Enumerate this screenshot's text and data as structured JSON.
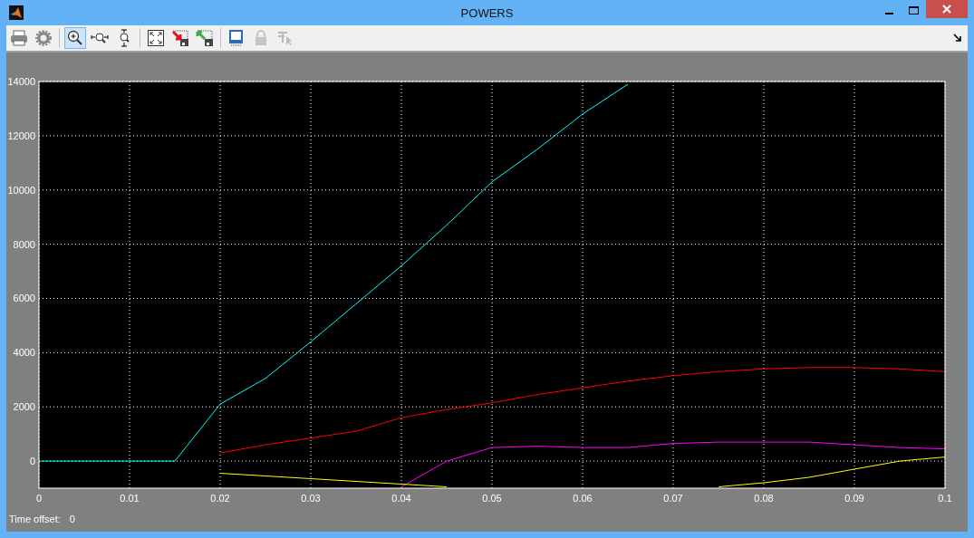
{
  "window": {
    "title": "POWERS"
  },
  "toolbar": [
    {
      "selected": false,
      "disabled": false
    },
    {
      "selected": false,
      "disabled": false
    },
    {
      "selected": true,
      "disabled": false
    },
    {
      "selected": false,
      "disabled": false
    },
    {
      "selected": false,
      "disabled": false
    },
    {
      "selected": false,
      "disabled": false
    },
    {
      "selected": false,
      "disabled": false
    },
    {
      "selected": false,
      "disabled": false
    },
    {
      "selected": false,
      "disabled": false
    },
    {
      "selected": false,
      "disabled": true
    },
    {
      "selected": false,
      "disabled": true
    }
  ],
  "chart_data": {
    "type": "line",
    "grid": true,
    "x": [
      0,
      0.005,
      0.01,
      0.015,
      0.02,
      0.025,
      0.03,
      0.035,
      0.04,
      0.045,
      0.05,
      0.055,
      0.06,
      0.065,
      0.07,
      0.075,
      0.08,
      0.085,
      0.09,
      0.095,
      0.1
    ],
    "xlim": [
      0,
      0.1
    ],
    "ylim": [
      -1000,
      14000
    ],
    "xticks": [
      0,
      0.01,
      0.02,
      0.03,
      0.04,
      0.05,
      0.06,
      0.07,
      0.08,
      0.09,
      {
        "value": 0.1,
        "label": "0.1"
      }
    ],
    "yticks": [
      0,
      2000,
      4000,
      6000,
      8000,
      10000,
      12000,
      14000
    ],
    "series": [
      {
        "color": "#00ffff",
        "values": [
          0,
          0,
          0,
          0,
          2100,
          3050,
          4400,
          5800,
          7200,
          8700,
          10300,
          11500,
          12800,
          13900,
          null,
          null,
          null,
          null,
          null,
          null,
          null
        ]
      },
      {
        "color": "#ff0000",
        "values": [
          null,
          null,
          null,
          null,
          300,
          600,
          850,
          1100,
          1600,
          1900,
          2150,
          2450,
          2700,
          2950,
          3150,
          3300,
          3400,
          3450,
          3450,
          3400,
          3300
        ]
      },
      {
        "color": "#ff00ff",
        "values": [
          null,
          null,
          null,
          null,
          null,
          null,
          null,
          null,
          -950,
          0,
          500,
          550,
          500,
          500,
          650,
          700,
          700,
          700,
          600,
          500,
          450
        ]
      },
      {
        "color": "#ffff00",
        "values": [
          null,
          null,
          null,
          null,
          -450,
          -550,
          -650,
          -750,
          -850,
          -950,
          null,
          null,
          null,
          null,
          null,
          -950,
          -800,
          -600,
          -300,
          0,
          150
        ]
      }
    ]
  },
  "status": {
    "label": "Time offset:",
    "value": "0"
  }
}
